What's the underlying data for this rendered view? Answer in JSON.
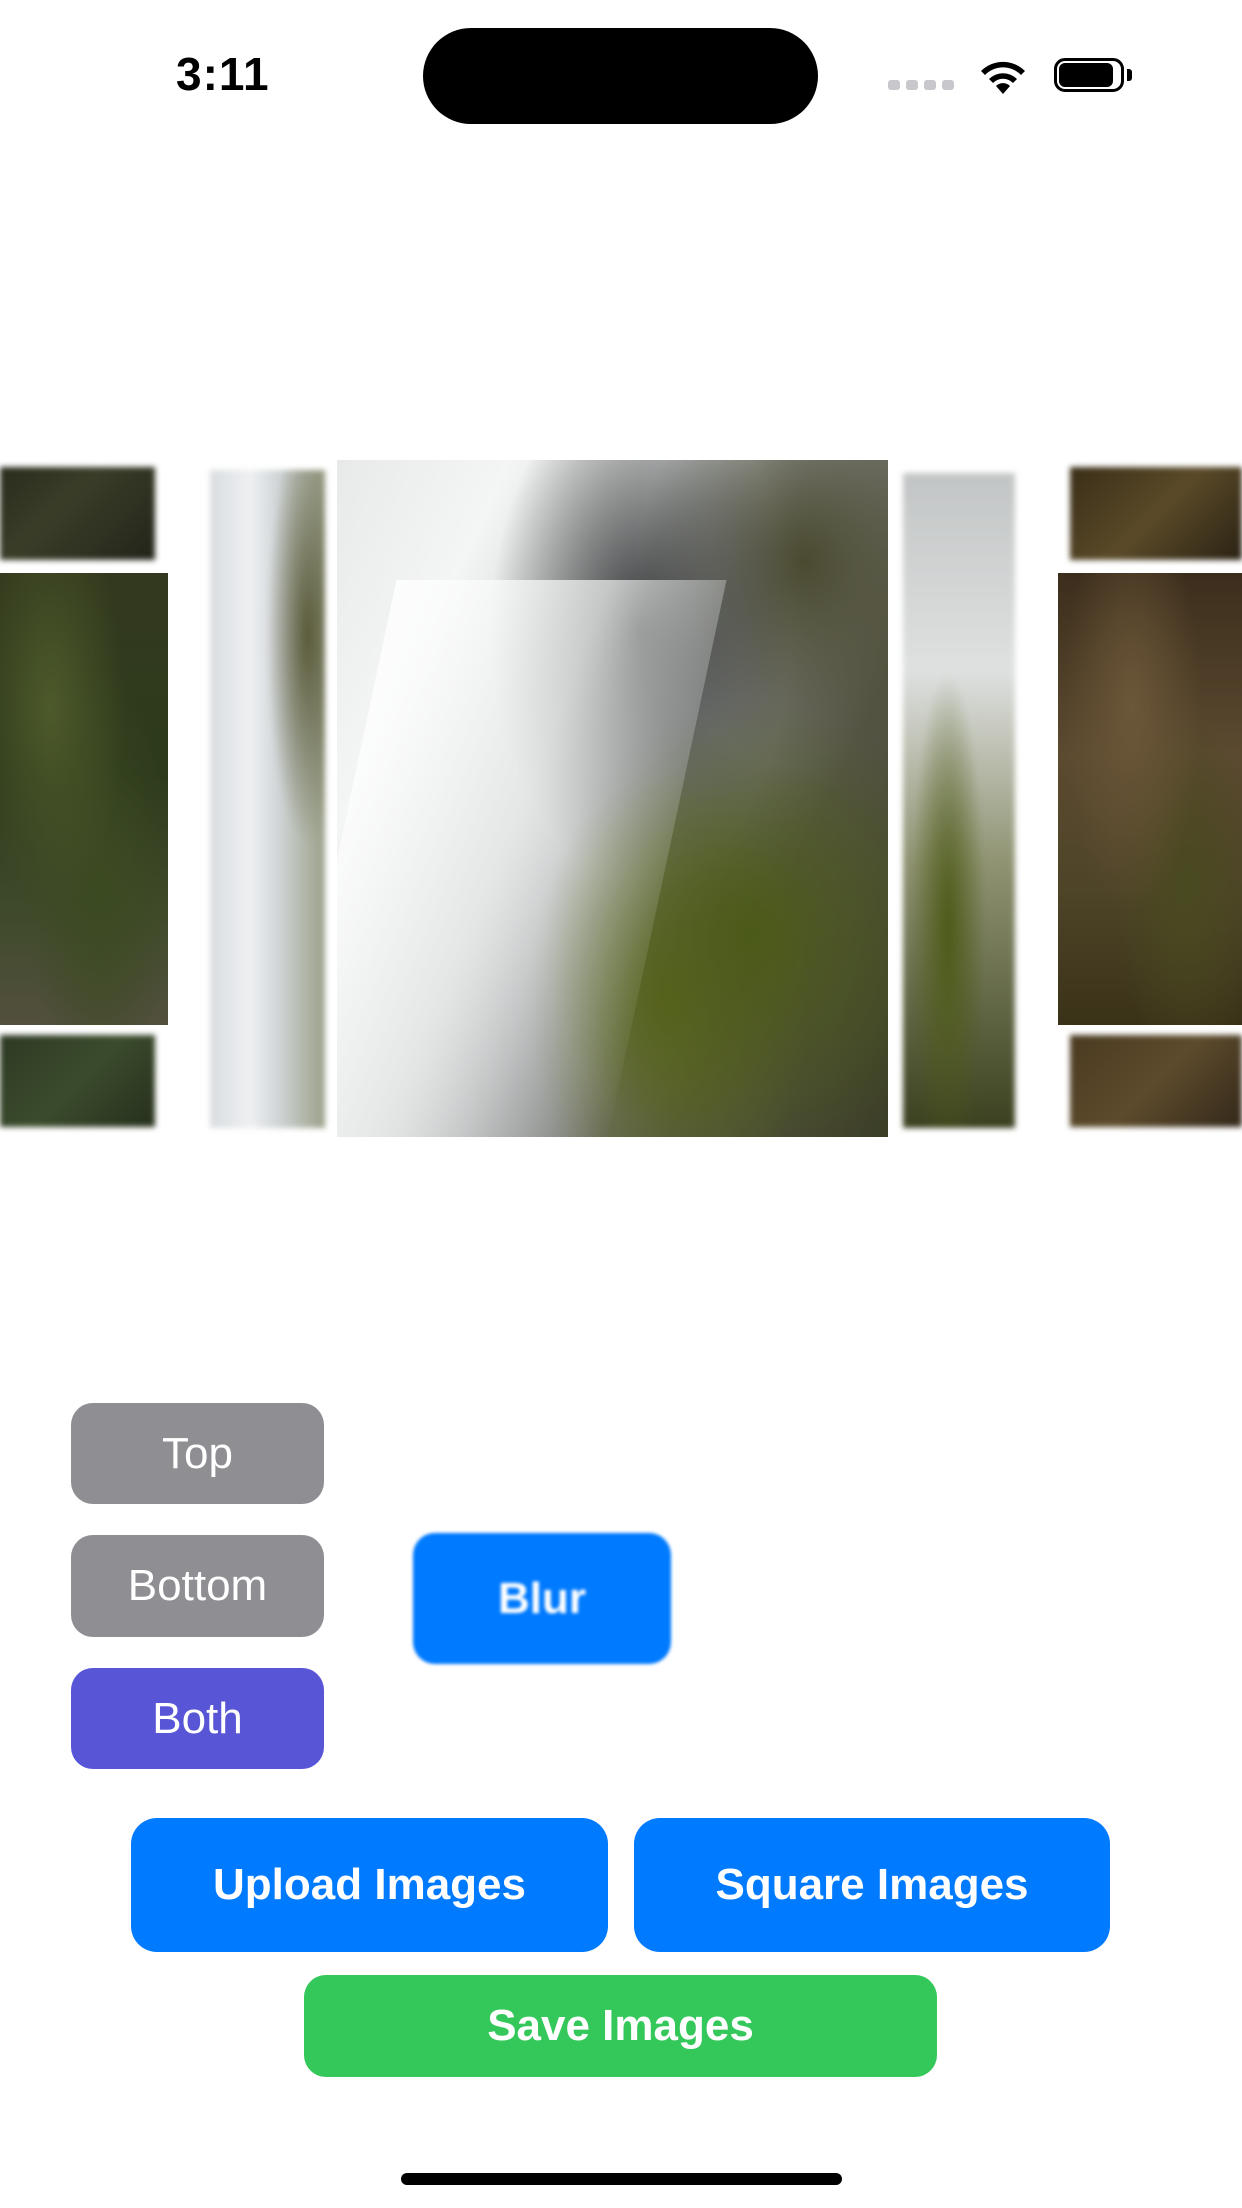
{
  "status_bar": {
    "time": "3:11",
    "icons": [
      "cellular-signal-icon",
      "wifi-icon",
      "battery-icon"
    ]
  },
  "carousel": {
    "images": [
      {
        "name": "moss-hillside",
        "state": "partial"
      },
      {
        "name": "waterfall-blurred-left",
        "state": "blurred"
      },
      {
        "name": "waterfall-rocks",
        "state": "selected"
      },
      {
        "name": "waterfall-blurred-right",
        "state": "blurred"
      },
      {
        "name": "rocky-cliff",
        "state": "partial"
      }
    ]
  },
  "controls": {
    "top_label": "Top",
    "bottom_label": "Bottom",
    "both_label": "Both",
    "blur_label": "Blur",
    "selected_mode": "Both"
  },
  "actions": {
    "upload_label": "Upload Images",
    "square_label": "Square Images",
    "save_label": "Save Images"
  },
  "colors": {
    "gray": "#8e8e93",
    "indigo": "#5856d6",
    "blue": "#007aff",
    "green": "#34c759"
  }
}
